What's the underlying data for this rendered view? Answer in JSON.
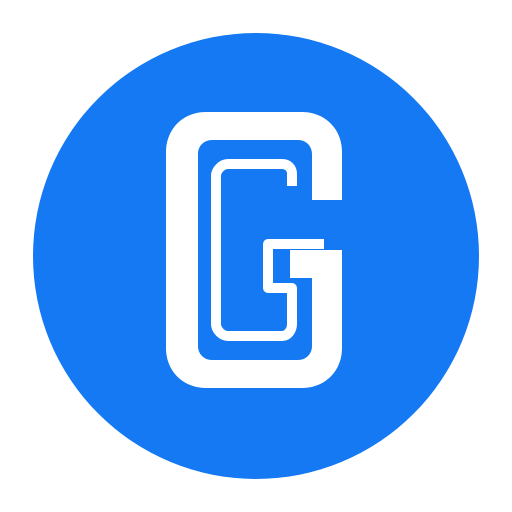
{
  "logo": {
    "icon": "letter-g-inline-logo",
    "letter": "G",
    "colors": {
      "background": "#FFFFFF",
      "circle": "#1479F2",
      "glyph": "#FFFFFF"
    }
  }
}
